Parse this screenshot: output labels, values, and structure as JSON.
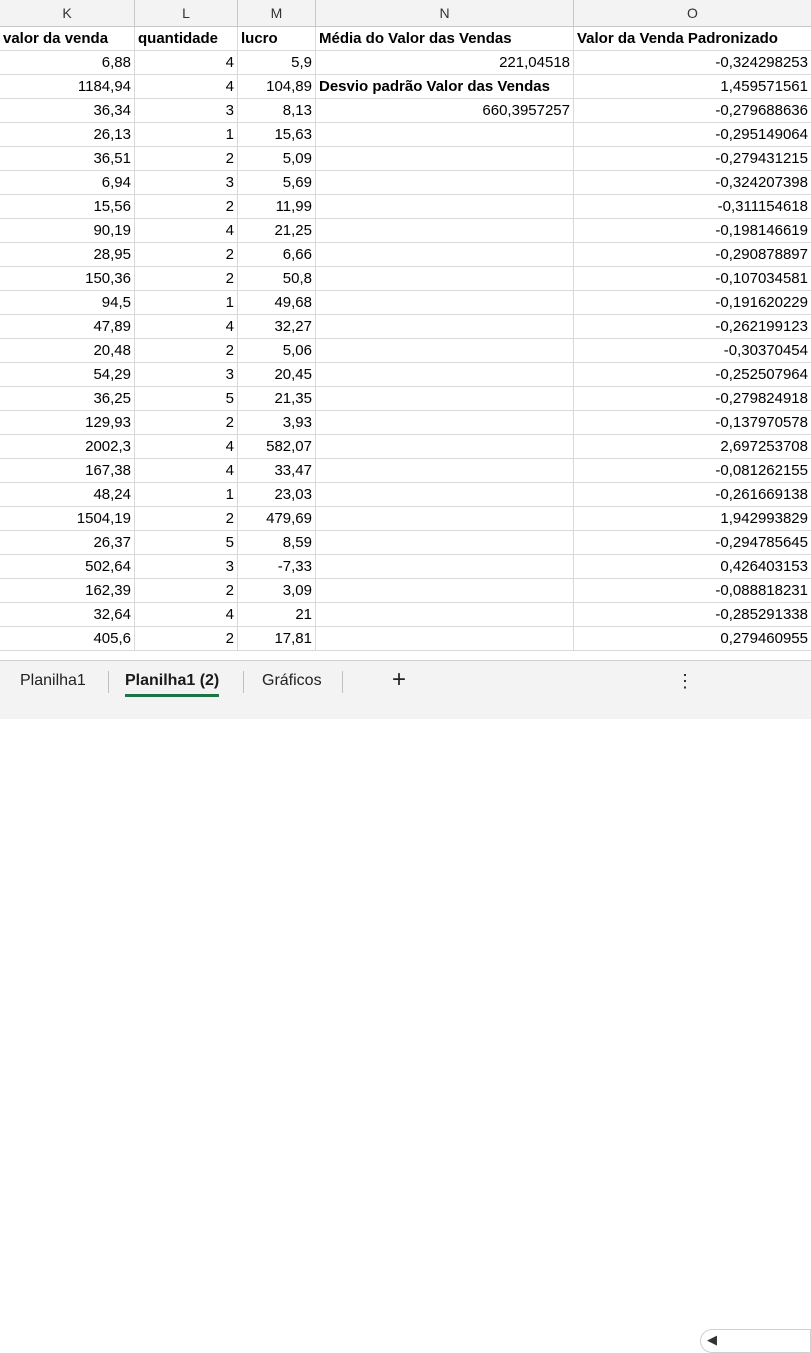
{
  "columns": [
    "K",
    "L",
    "M",
    "N",
    "O"
  ],
  "headers": {
    "k": "valor da venda",
    "l": "quantidade",
    "m": "lucro",
    "n": "Média do Valor das Vendas",
    "o": "Valor da Venda Padronizado"
  },
  "side": {
    "mean_value": "221,04518",
    "std_label": "Desvio padrão Valor das Vendas",
    "std_value": "660,3957257"
  },
  "rows": [
    [
      "6,88",
      "4",
      "5,9",
      "-0,324298253"
    ],
    [
      "1184,94",
      "4",
      "104,89",
      "1,459571561"
    ],
    [
      "36,34",
      "3",
      "8,13",
      "-0,279688636"
    ],
    [
      "26,13",
      "1",
      "15,63",
      "-0,295149064"
    ],
    [
      "36,51",
      "2",
      "5,09",
      "-0,279431215"
    ],
    [
      "6,94",
      "3",
      "5,69",
      "-0,324207398"
    ],
    [
      "15,56",
      "2",
      "11,99",
      "-0,311154618"
    ],
    [
      "90,19",
      "4",
      "21,25",
      "-0,198146619"
    ],
    [
      "28,95",
      "2",
      "6,66",
      "-0,290878897"
    ],
    [
      "150,36",
      "2",
      "50,8",
      "-0,107034581"
    ],
    [
      "94,5",
      "1",
      "49,68",
      "-0,191620229"
    ],
    [
      "47,89",
      "4",
      "32,27",
      "-0,262199123"
    ],
    [
      "20,48",
      "2",
      "5,06",
      "-0,30370454"
    ],
    [
      "54,29",
      "3",
      "20,45",
      "-0,252507964"
    ],
    [
      "36,25",
      "5",
      "21,35",
      "-0,279824918"
    ],
    [
      "129,93",
      "2",
      "3,93",
      "-0,137970578"
    ],
    [
      "2002,3",
      "4",
      "582,07",
      "2,697253708"
    ],
    [
      "167,38",
      "4",
      "33,47",
      "-0,081262155"
    ],
    [
      "48,24",
      "1",
      "23,03",
      "-0,261669138"
    ],
    [
      "1504,19",
      "2",
      "479,69",
      "1,942993829"
    ],
    [
      "26,37",
      "5",
      "8,59",
      "-0,294785645"
    ],
    [
      "502,64",
      "3",
      "-7,33",
      "0,426403153"
    ],
    [
      "162,39",
      "2",
      "3,09",
      "-0,088818231"
    ],
    [
      "32,64",
      "4",
      "21",
      "-0,285291338"
    ],
    [
      "405,6",
      "2",
      "17,81",
      "0,279460955"
    ]
  ],
  "tabs": [
    "Planilha1",
    "Planilha1 (2)",
    "Gráficos"
  ],
  "add_tab": "+",
  "more": "⋮",
  "scroll_left": "◀"
}
